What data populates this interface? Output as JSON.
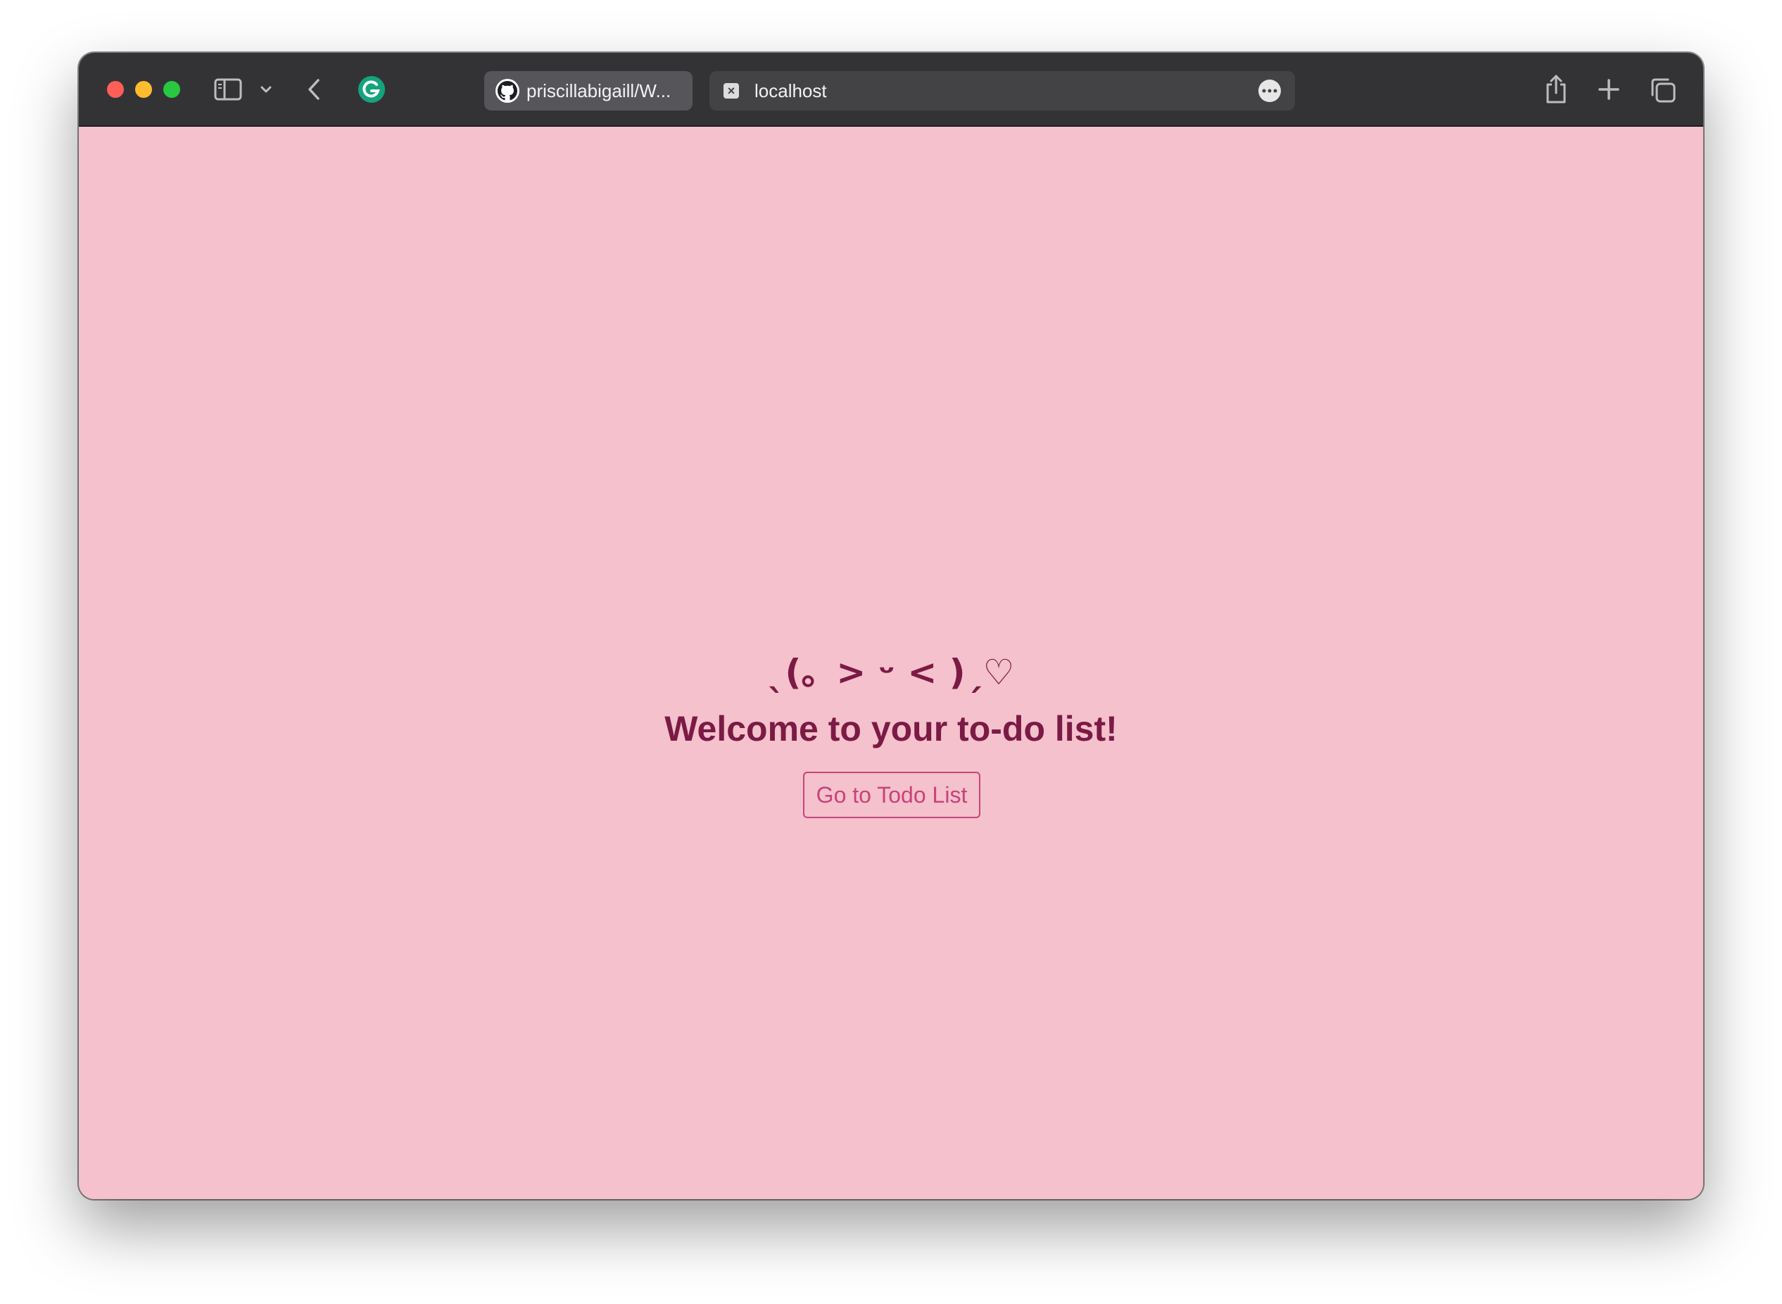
{
  "browser": {
    "tabs": [
      {
        "label": "priscillabigaill/W...",
        "favicon": "github-icon",
        "active": false
      },
      {
        "label": "localhost",
        "favicon": "close-tab-icon",
        "active": true
      }
    ],
    "icons": [
      "sidebar-icon",
      "chevron-down-icon",
      "back-arrow-icon",
      "grammarly-icon",
      "more-icon",
      "share-icon",
      "new-tab-plus-icon",
      "tab-overview-icon"
    ]
  },
  "page": {
    "kaomoji": "ˎ(。> ᵕ < )ˏ♡",
    "heading": "Welcome to your to-do list!",
    "button_label": "Go to Todo List"
  },
  "colors": {
    "background": "#f4c1cc",
    "heading": "#7b1a45",
    "button": "#c8437a",
    "titlebar": "#333336"
  }
}
